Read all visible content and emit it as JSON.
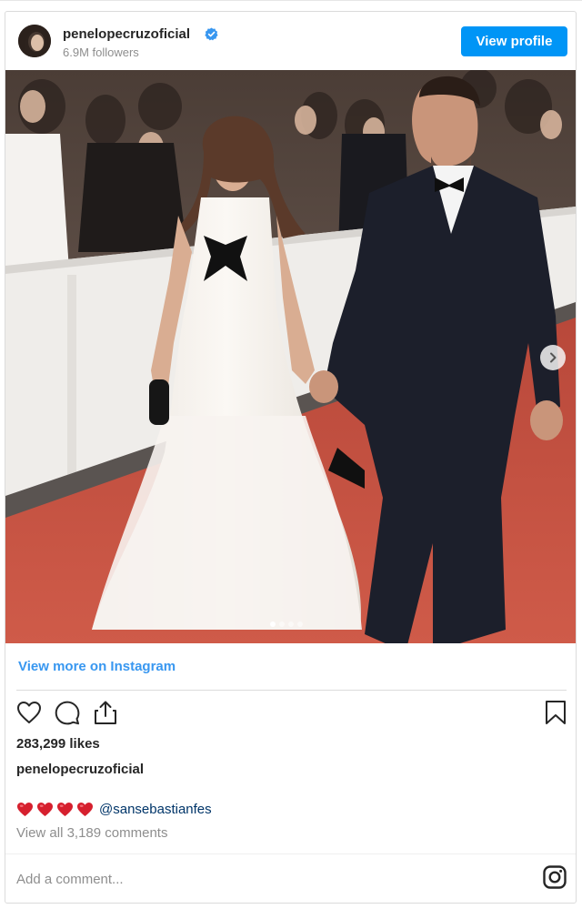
{
  "header": {
    "username": "penelopecruzoficial",
    "followers": "6.9M followers",
    "view_profile_label": "View profile",
    "verified_icon": "verified-badge-icon",
    "accent": "#0095f6"
  },
  "media": {
    "next_icon": "chevron-right-icon",
    "dots_total": 4,
    "dots_active": 1
  },
  "view_more_label": "View more on Instagram",
  "actions": {
    "like_icon": "heart-outline-icon",
    "comment_icon": "comment-bubble-icon",
    "share_icon": "share-upload-icon",
    "save_icon": "bookmark-icon"
  },
  "likes": "283,299 likes",
  "caption": {
    "username": "penelopecruzoficial",
    "emoji_hearts": [
      "❤️",
      "❤️",
      "❤️",
      "❤️"
    ],
    "mention": "@sansebastianfes"
  },
  "view_comments": "View all 3,189 comments",
  "add_comment_placeholder": "Add a comment...",
  "instagram_icon": "instagram-logo-icon"
}
